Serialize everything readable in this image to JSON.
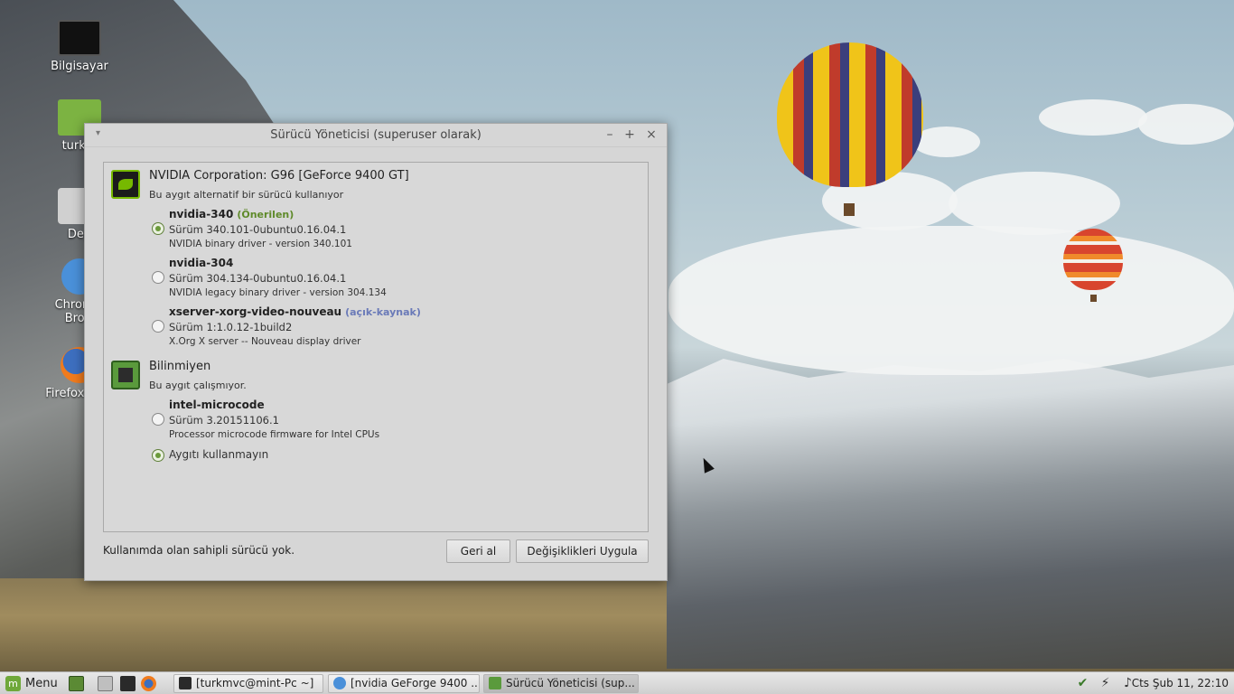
{
  "desktop": {
    "icons": [
      {
        "label": "Bilgisayar"
      },
      {
        "label": "turkm"
      },
      {
        "label": "Dep"
      },
      {
        "label": "Chromiu",
        "label2": "Brow"
      },
      {
        "label": "Firefox Web"
      }
    ]
  },
  "window": {
    "title": "Sürücü Yöneticisi (superuser olarak)",
    "controls": {
      "minimize": "–",
      "maximize": "+",
      "close": "×",
      "menu": "▾"
    },
    "devices": [
      {
        "title": "NVIDIA Corporation: G96 [GeForce 9400 GT]",
        "status": "Bu aygıt alternatif bir sürücü kullanıyor",
        "drivers": [
          {
            "name": "nvidia-340",
            "tag": "(Önerilen)",
            "version": "Sürüm 340.101-0ubuntu0.16.04.1",
            "desc": "NVIDIA binary driver - version 340.101",
            "selected": true
          },
          {
            "name": "nvidia-304",
            "tag": "",
            "version": "Sürüm 304.134-0ubuntu0.16.04.1",
            "desc": "NVIDIA legacy binary driver - version 304.134",
            "selected": false
          },
          {
            "name": "xserver-xorg-video-nouveau",
            "tag": "(açık-kaynak)",
            "version": "Sürüm 1:1.0.12-1build2",
            "desc": "X.Org X server -- Nouveau display driver",
            "selected": false
          }
        ]
      },
      {
        "title": "Bilinmiyen",
        "status": "Bu aygıt çalışmıyor.",
        "drivers": [
          {
            "name": "intel-microcode",
            "version": "Sürüm 3.20151106.1",
            "desc": "Processor microcode firmware for Intel CPUs",
            "selected": false
          }
        ],
        "option_disable": "Aygıtı kullanmayın"
      }
    ],
    "footer_text": "Kullanımda olan sahipli sürücü yok.",
    "revert_button": "Geri al",
    "apply_button": "Değişiklikleri Uygula"
  },
  "taskbar": {
    "menu_label": "Menu",
    "tasks": [
      {
        "label": "[turkmvc@mint-Pc ~]"
      },
      {
        "label": "[nvidia GeForge 9400 ..."
      },
      {
        "label": "Sürücü Yöneticisi (sup..."
      }
    ],
    "clock": "Cts Şub 11, 22:10"
  },
  "colors": {
    "accent": "#6a9a3a",
    "recommended": "#5f8a2a",
    "open_source": "#6a7ab8"
  }
}
